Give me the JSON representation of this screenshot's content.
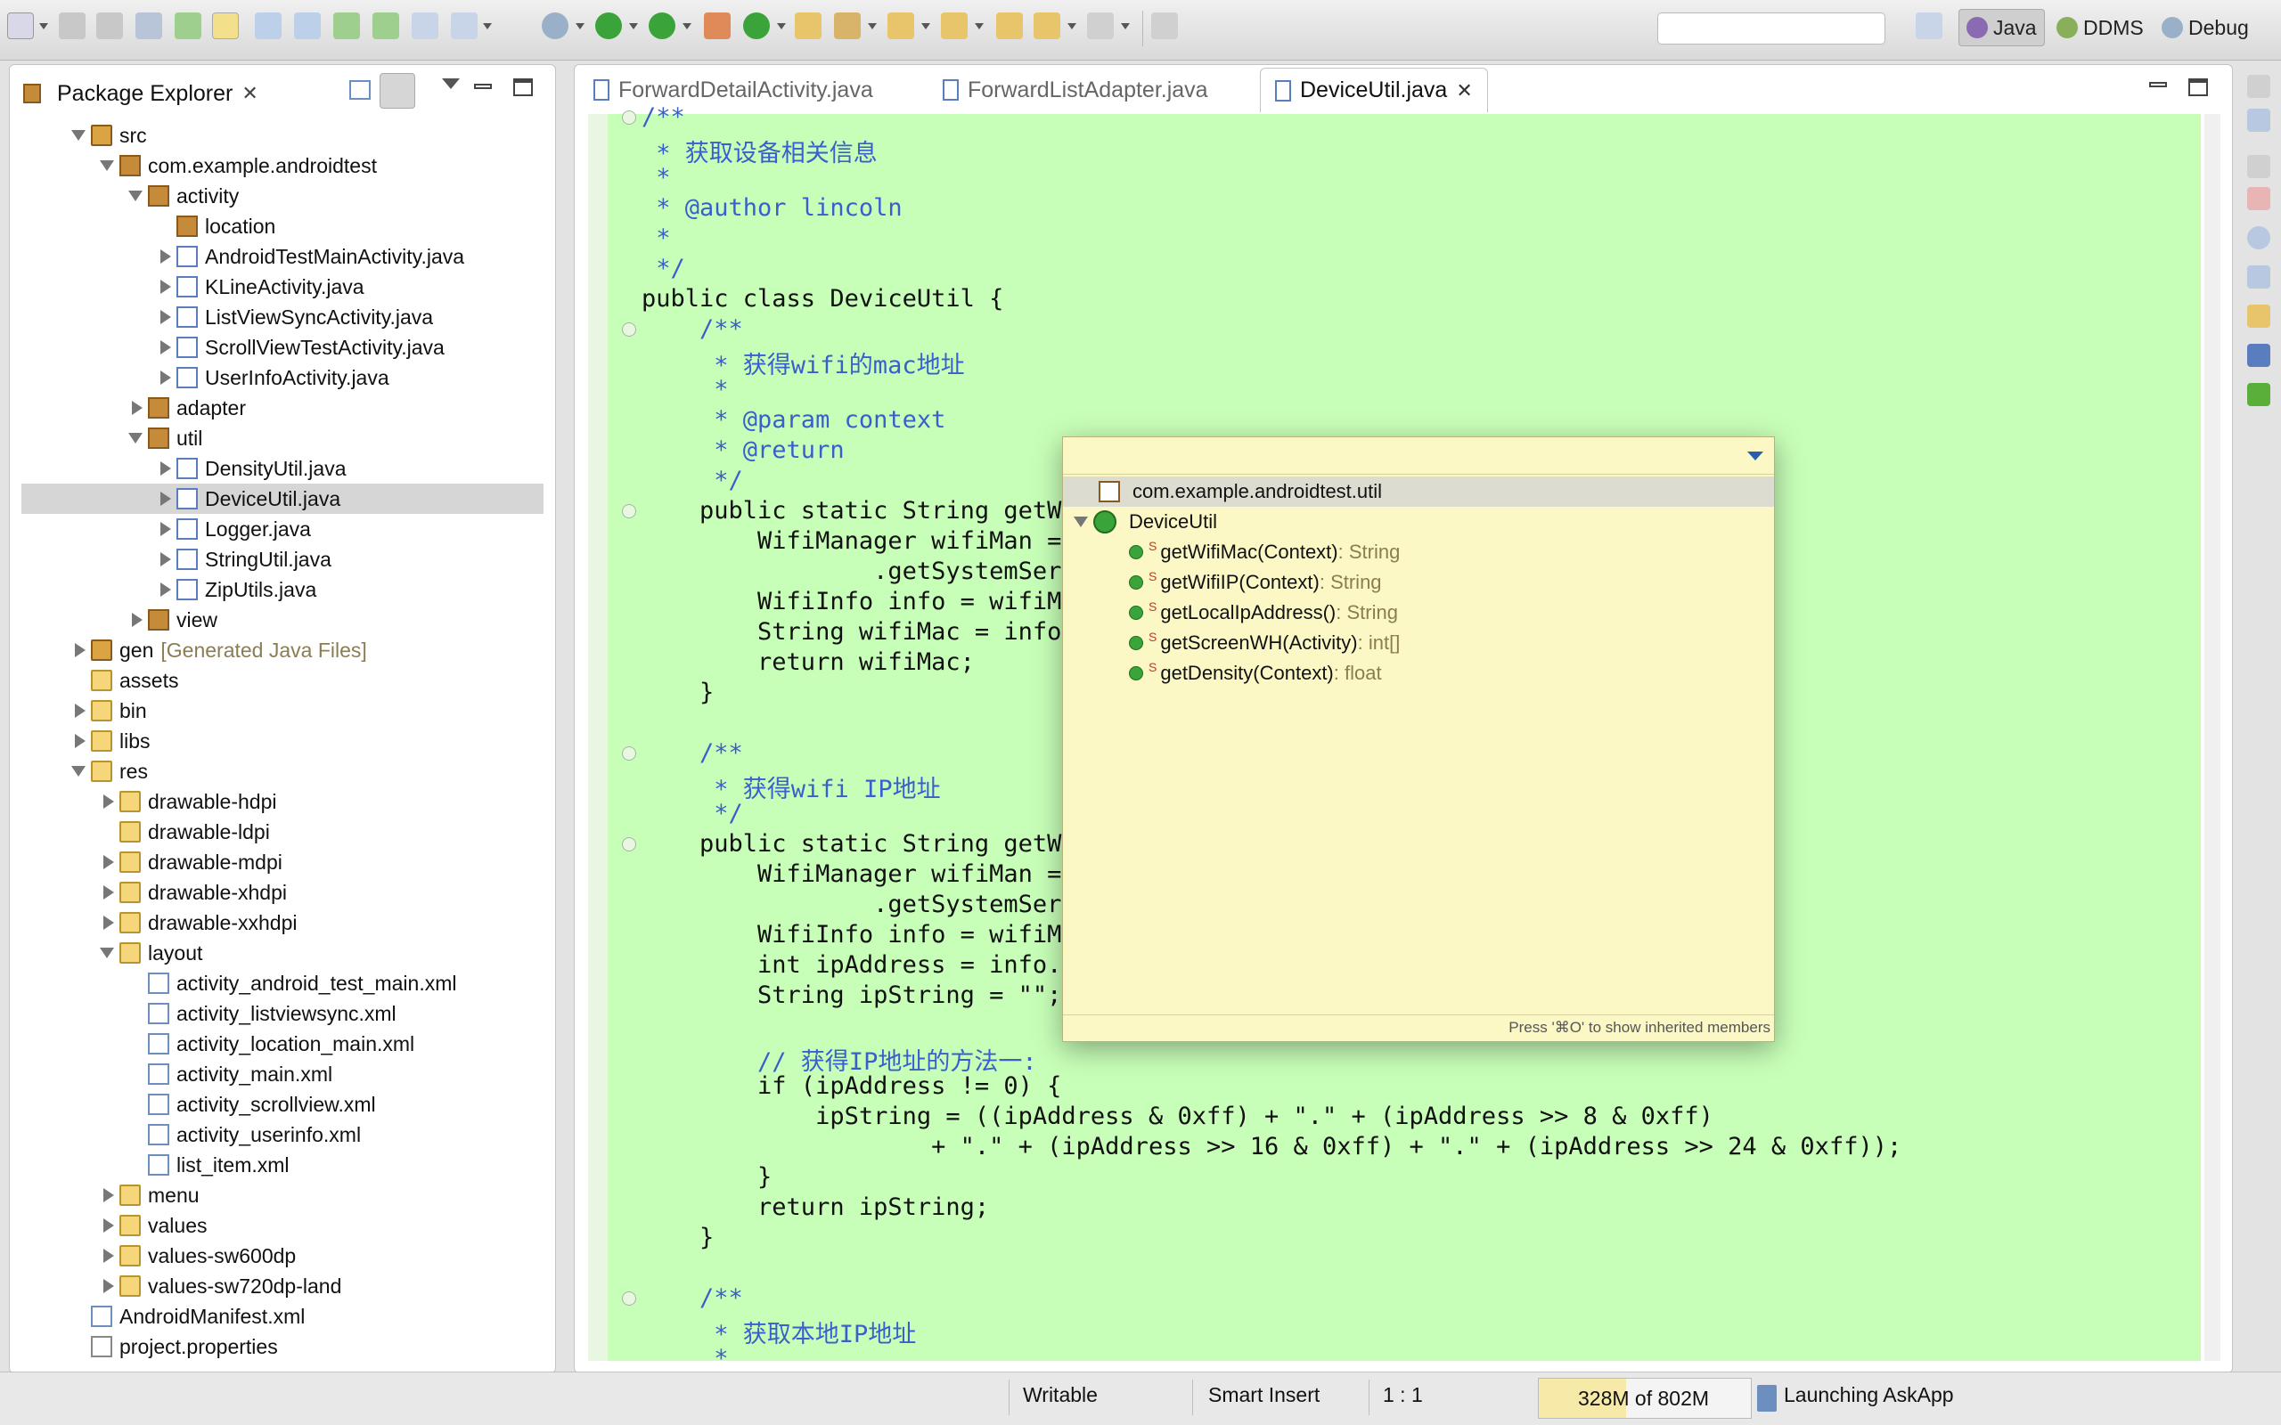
{
  "toolbar": {
    "search_value": "",
    "perspectives": [
      {
        "label": "Java",
        "active": true
      },
      {
        "label": "DDMS",
        "active": false
      },
      {
        "label": "Debug",
        "active": false
      }
    ]
  },
  "package_explorer": {
    "title": "Package Explorer",
    "tree": [
      {
        "label": "src",
        "icon": "source-folder-icon",
        "level": 1,
        "state": "open"
      },
      {
        "label": "com.example.androidtest",
        "icon": "package-icon",
        "level": 2,
        "state": "open"
      },
      {
        "label": "activity",
        "icon": "package-icon",
        "level": 3,
        "state": "open"
      },
      {
        "label": "location",
        "icon": "package-icon",
        "level": 4,
        "state": "none"
      },
      {
        "label": "AndroidTestMainActivity.java",
        "icon": "java-file-icon",
        "level": 4,
        "state": "closed"
      },
      {
        "label": "KLineActivity.java",
        "icon": "java-file-icon",
        "level": 4,
        "state": "closed"
      },
      {
        "label": "ListViewSyncActivity.java",
        "icon": "java-file-icon",
        "level": 4,
        "state": "closed"
      },
      {
        "label": "ScrollViewTestActivity.java",
        "icon": "java-file-icon",
        "level": 4,
        "state": "closed"
      },
      {
        "label": "UserInfoActivity.java",
        "icon": "java-file-icon",
        "level": 4,
        "state": "closed"
      },
      {
        "label": "adapter",
        "icon": "package-icon",
        "level": 3,
        "state": "closed"
      },
      {
        "label": "util",
        "icon": "package-icon",
        "level": 3,
        "state": "open"
      },
      {
        "label": "DensityUtil.java",
        "icon": "java-file-icon",
        "level": 4,
        "state": "closed"
      },
      {
        "label": "DeviceUtil.java",
        "icon": "java-file-icon",
        "level": 4,
        "state": "closed",
        "selected": true
      },
      {
        "label": "Logger.java",
        "icon": "java-file-icon",
        "level": 4,
        "state": "closed"
      },
      {
        "label": "StringUtil.java",
        "icon": "java-file-icon",
        "level": 4,
        "state": "closed"
      },
      {
        "label": "ZipUtils.java",
        "icon": "java-file-icon",
        "level": 4,
        "state": "closed"
      },
      {
        "label": "view",
        "icon": "package-icon",
        "level": 3,
        "state": "closed"
      },
      {
        "label": "gen",
        "suffix": "[Generated Java Files]",
        "icon": "source-folder-icon",
        "level": 1,
        "state": "closed"
      },
      {
        "label": "assets",
        "icon": "folder-icon",
        "level": 1,
        "state": "none"
      },
      {
        "label": "bin",
        "icon": "folder-icon",
        "level": 1,
        "state": "closed"
      },
      {
        "label": "libs",
        "icon": "folder-icon",
        "level": 1,
        "state": "closed"
      },
      {
        "label": "res",
        "icon": "folder-icon",
        "level": 1,
        "state": "open"
      },
      {
        "label": "drawable-hdpi",
        "icon": "folder-icon",
        "level": 2,
        "state": "closed"
      },
      {
        "label": "drawable-ldpi",
        "icon": "folder-icon",
        "level": 2,
        "state": "none"
      },
      {
        "label": "drawable-mdpi",
        "icon": "folder-icon",
        "level": 2,
        "state": "closed"
      },
      {
        "label": "drawable-xhdpi",
        "icon": "folder-icon",
        "level": 2,
        "state": "closed"
      },
      {
        "label": "drawable-xxhdpi",
        "icon": "folder-icon",
        "level": 2,
        "state": "closed"
      },
      {
        "label": "layout",
        "icon": "folder-icon",
        "level": 2,
        "state": "open"
      },
      {
        "label": "activity_android_test_main.xml",
        "icon": "xml-file-icon",
        "level": 3,
        "state": "none"
      },
      {
        "label": "activity_listviewsync.xml",
        "icon": "xml-file-icon",
        "level": 3,
        "state": "none"
      },
      {
        "label": "activity_location_main.xml",
        "icon": "xml-file-icon",
        "level": 3,
        "state": "none"
      },
      {
        "label": "activity_main.xml",
        "icon": "xml-file-icon",
        "level": 3,
        "state": "none"
      },
      {
        "label": "activity_scrollview.xml",
        "icon": "xml-file-icon",
        "level": 3,
        "state": "none"
      },
      {
        "label": "activity_userinfo.xml",
        "icon": "xml-file-icon",
        "level": 3,
        "state": "none"
      },
      {
        "label": "list_item.xml",
        "icon": "xml-file-icon",
        "level": 3,
        "state": "none"
      },
      {
        "label": "menu",
        "icon": "folder-icon",
        "level": 2,
        "state": "closed"
      },
      {
        "label": "values",
        "icon": "folder-icon",
        "level": 2,
        "state": "closed"
      },
      {
        "label": "values-sw600dp",
        "icon": "folder-icon",
        "level": 2,
        "state": "closed"
      },
      {
        "label": "values-sw720dp-land",
        "icon": "folder-icon",
        "level": 2,
        "state": "closed"
      },
      {
        "label": "AndroidManifest.xml",
        "icon": "xml-file-icon",
        "level": 1,
        "state": "none"
      },
      {
        "label": "project.properties",
        "icon": "text-file-icon",
        "level": 1,
        "state": "none"
      }
    ]
  },
  "editor": {
    "tabs": [
      {
        "label": "ForwardDetailActivity.java",
        "active": false
      },
      {
        "label": "ForwardListAdapter.java",
        "active": false
      },
      {
        "label": "DeviceUtil.java",
        "active": true
      }
    ],
    "lines": [
      {
        "t": "/**",
        "c": "cm"
      },
      {
        "t": " * 获取设备相关信息",
        "c": "cm"
      },
      {
        "t": " *",
        "c": "cm"
      },
      {
        "t": " * @author lincoln",
        "c": "cm"
      },
      {
        "t": " *",
        "c": "cm"
      },
      {
        "t": " */",
        "c": "cm"
      },
      {
        "t": "public class DeviceUtil {",
        "c": ""
      },
      {
        "t": "    /**",
        "c": "cm"
      },
      {
        "t": "     * 获得wifi的mac地址",
        "c": "cm"
      },
      {
        "t": "     *",
        "c": "cm"
      },
      {
        "t": "     * @param context",
        "c": "cm"
      },
      {
        "t": "     * @return",
        "c": "cm"
      },
      {
        "t": "     */",
        "c": "cm"
      },
      {
        "t": "    public static String getWi",
        "c": ""
      },
      {
        "t": "        WifiManager wifiMan =",
        "c": ""
      },
      {
        "t": "                .getSystemServ",
        "c": ""
      },
      {
        "t": "        WifiInfo info = wifiMa",
        "c": ""
      },
      {
        "t": "        String wifiMac = info",
        "c": ""
      },
      {
        "t": "        return wifiMac;",
        "c": ""
      },
      {
        "t": "    }",
        "c": ""
      },
      {
        "t": "",
        "c": ""
      },
      {
        "t": "    /**",
        "c": "cm"
      },
      {
        "t": "     * 获得wifi IP地址",
        "c": "cm"
      },
      {
        "t": "     */",
        "c": "cm"
      },
      {
        "t": "    public static String getWi",
        "c": ""
      },
      {
        "t": "        WifiManager wifiMan =",
        "c": ""
      },
      {
        "t": "                .getSystemServ",
        "c": ""
      },
      {
        "t": "        WifiInfo info = wifiMa",
        "c": ""
      },
      {
        "t": "        int ipAddress = info.g",
        "c": ""
      },
      {
        "t": "        String ipString = \"\";",
        "c": ""
      },
      {
        "t": "",
        "c": ""
      },
      {
        "t": "        // 获得IP地址的方法一:",
        "c": "cm"
      },
      {
        "t": "        if (ipAddress != 0) {",
        "c": ""
      },
      {
        "t": "            ipString = ((ipAddress & 0xff) + \".\" + (ipAddress >> 8 & 0xff)",
        "c": ""
      },
      {
        "t": "                    + \".\" + (ipAddress >> 16 & 0xff) + \".\" + (ipAddress >> 24 & 0xff));",
        "c": ""
      },
      {
        "t": "        }",
        "c": ""
      },
      {
        "t": "        return ipString;",
        "c": ""
      },
      {
        "t": "    }",
        "c": ""
      },
      {
        "t": "",
        "c": ""
      },
      {
        "t": "    /**",
        "c": "cm"
      },
      {
        "t": "     * 获取本地IP地址",
        "c": "cm"
      },
      {
        "t": "     *",
        "c": "cm"
      }
    ]
  },
  "outline_popup": {
    "package": "com.example.androidtest.util",
    "class": "DeviceUtil",
    "members": [
      {
        "name": "getWifiMac(Context)",
        "type": " : String"
      },
      {
        "name": "getWifiIP(Context)",
        "type": " : String"
      },
      {
        "name": "getLocalIpAddress()",
        "type": " : String"
      },
      {
        "name": "getScreenWH(Activity)",
        "type": " : int[]"
      },
      {
        "name": "getDensity(Context)",
        "type": " : float"
      }
    ],
    "static_marker": "S",
    "footer": "Press '⌘O' to show inherited members"
  },
  "status_bar": {
    "writable": "Writable",
    "insert_mode": "Smart Insert",
    "position": "1 : 1",
    "memory": "328M of 802M",
    "memory_fraction": 0.41,
    "job": "Launching AskApp"
  }
}
